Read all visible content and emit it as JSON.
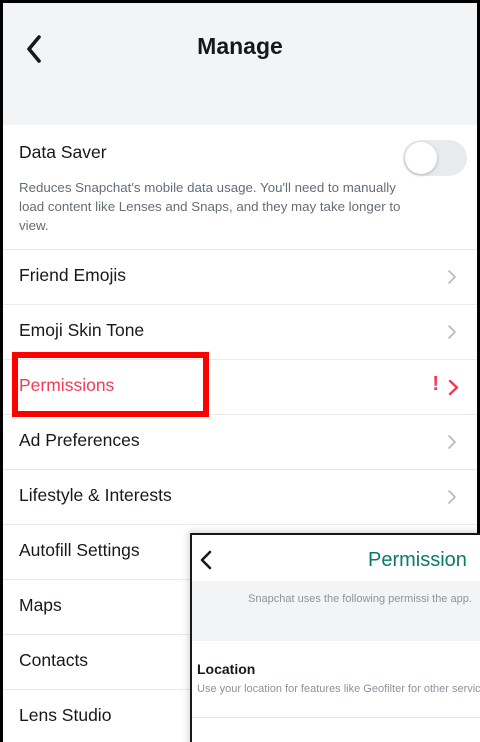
{
  "header": {
    "title": "Manage"
  },
  "data_saver": {
    "label": "Data Saver",
    "description": "Reduces Snapchat's mobile data usage. You'll need to manually load content like Lenses and Snaps, and they may take longer to view.",
    "enabled": false
  },
  "rows": {
    "friend_emojis": "Friend Emojis",
    "emoji_skin_tone": "Emoji Skin Tone",
    "permissions": "Permissions",
    "permissions_alert": "!",
    "ad_preferences": "Ad Preferences",
    "lifestyle_interests": "Lifestyle & Interests",
    "autofill_settings": "Autofill Settings",
    "maps": "Maps",
    "contacts": "Contacts",
    "lens_studio": "Lens Studio"
  },
  "colors": {
    "accent_red": "#f23c57",
    "highlight": "#ff0000",
    "inset_title": "#0a7a67"
  },
  "inset": {
    "title": "Permission",
    "intro": "Snapchat uses the following permissi the app.",
    "location_title": "Location",
    "location_desc": "Use your location for features like Geofilter for other services that improve your experi"
  }
}
